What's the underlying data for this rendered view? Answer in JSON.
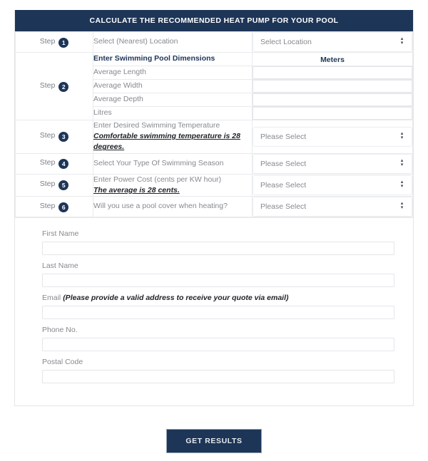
{
  "calculator": {
    "header_title": "CALCULATE THE RECOMMENDED HEAT PUMP FOR YOUR POOL",
    "colors": {
      "navy": "#1d3557",
      "border": "#e8eaec",
      "label_gray": "#85898f"
    },
    "steps": [
      {
        "step_word": "Step",
        "number": "1",
        "label": "Select (Nearest) Location",
        "note": "",
        "control": "select",
        "value": "Select Location"
      },
      {
        "step_word": "Step",
        "number": "2",
        "label": "Enter Swimming Pool Dimensions",
        "note": "",
        "control": "header",
        "value": "Meters",
        "sub_rows": [
          {
            "label": "Average Length",
            "value": ""
          },
          {
            "label": "Average Width",
            "value": ""
          },
          {
            "label": "Average Depth",
            "value": ""
          },
          {
            "label": "Litres",
            "value": ""
          }
        ]
      },
      {
        "step_word": "Step",
        "number": "3",
        "label": "Enter Desired Swimming Temperature",
        "note": "Comfortable swimming temperature is 28 degrees.",
        "control": "select",
        "value": "Please Select"
      },
      {
        "step_word": "Step",
        "number": "4",
        "label": "Select Your Type Of Swimming Season",
        "note": "",
        "control": "select",
        "value": "Please Select"
      },
      {
        "step_word": "Step",
        "number": "5",
        "label": "Enter Power Cost (cents per KW hour)",
        "note": "The average is 28 cents.",
        "control": "select",
        "value": "Please Select"
      },
      {
        "step_word": "Step",
        "number": "6",
        "label": "Will you use a pool cover when heating?",
        "note": "",
        "control": "select",
        "value": "Please Select"
      }
    ],
    "dropdown_icon": "sort-arrows-icon",
    "up_arrow_glyph": "▴",
    "down_arrow_glyph": "▾"
  },
  "contact_form": {
    "fields": [
      {
        "label": "First Name",
        "emphasis": "",
        "value": "",
        "placeholder": ""
      },
      {
        "label": "Last Name",
        "emphasis": "",
        "value": "",
        "placeholder": ""
      },
      {
        "label": "Email",
        "emphasis": "(Please provide a valid address to receive your quote via email)",
        "value": "",
        "placeholder": ""
      },
      {
        "label": "Phone No.",
        "emphasis": "",
        "value": "",
        "placeholder": ""
      },
      {
        "label": "Postal Code",
        "emphasis": "",
        "value": "",
        "placeholder": ""
      }
    ]
  },
  "submit": {
    "label": "GET RESULTS"
  }
}
